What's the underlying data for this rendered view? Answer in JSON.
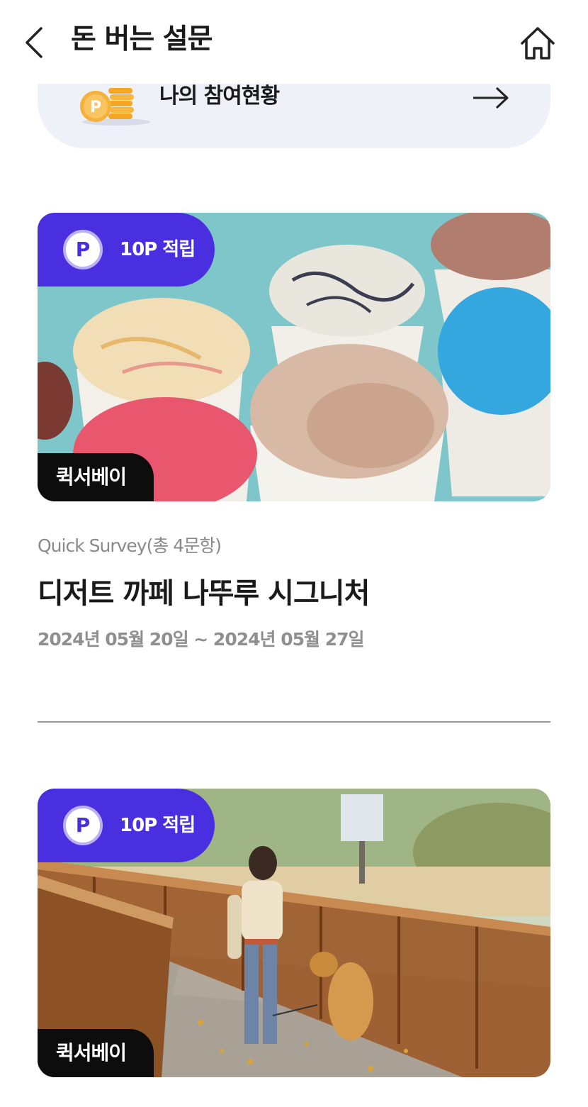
{
  "header": {
    "title": "돈 버는 설문",
    "back_icon": "chevron-left-icon",
    "home_icon": "home-icon"
  },
  "status_banner": {
    "label": "나의 참여현황",
    "coin_letter": "P",
    "arrow_icon": "arrow-right-icon"
  },
  "surveys": [
    {
      "point_letter": "P",
      "point_label": "10P 적립",
      "type_tag": "퀵서베이",
      "meta": "Quick Survey(총 4문항)",
      "title": "디저트 까페 나뚜루 시그니처",
      "period": "2024년 05월 20일 ~ 2024년 05월 27일",
      "image": "ice-cream-cups-photo"
    },
    {
      "point_letter": "P",
      "point_label": "10P 적립",
      "type_tag": "퀵서베이",
      "image": "woman-walking-dog-photo"
    }
  ],
  "colors": {
    "accent": "#4a2fe0",
    "banner_bg": "#eef1f8",
    "tag_bg": "#0d0d0d"
  }
}
